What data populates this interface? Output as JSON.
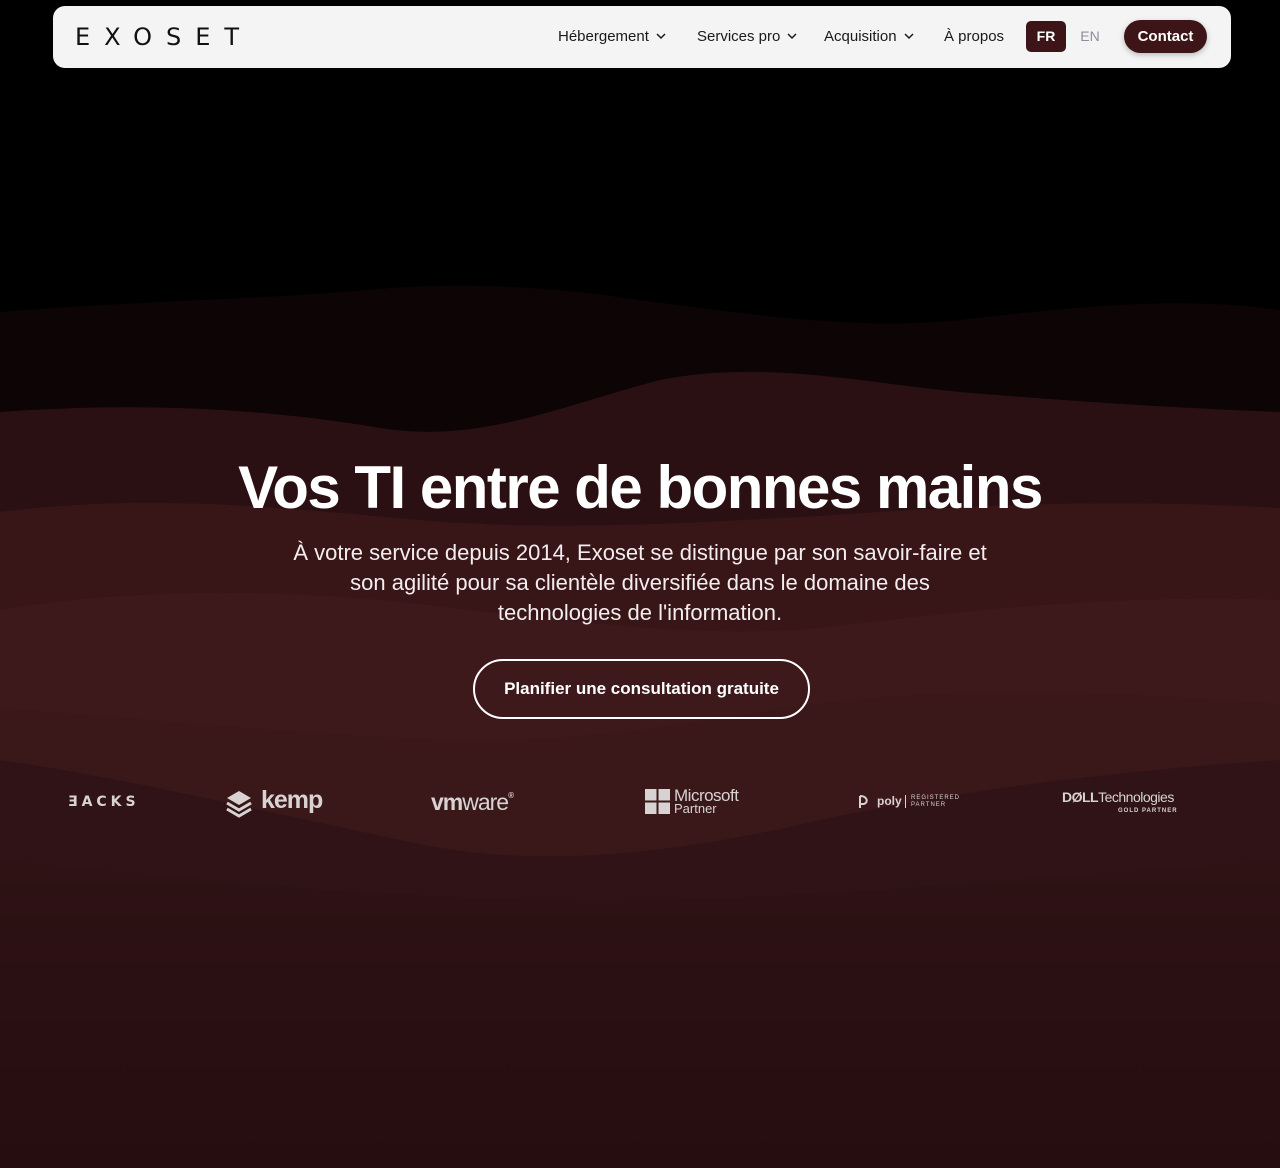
{
  "brand": {
    "logo_text": "EXOSET"
  },
  "nav": {
    "items": [
      {
        "label": "Hébergement",
        "has_dropdown": true
      },
      {
        "label": "Services pro",
        "has_dropdown": true
      },
      {
        "label": "Acquisition",
        "has_dropdown": true
      },
      {
        "label": "À propos",
        "has_dropdown": false
      }
    ],
    "lang_fr": "FR",
    "lang_en": "EN",
    "active_lang": "FR",
    "contact_label": "Contact"
  },
  "hero": {
    "title": "Vos TI entre de bonnes mains",
    "subtitle": "À votre service depuis 2014, Exoset se distingue par son savoir-faire et son agilité pour sa clientèle diversifiée dans le domaine des technologies de l'information.",
    "cta_label": "Planifier une consultation gratuite"
  },
  "partners": {
    "racks": "ƎACKS",
    "kemp": "kemp",
    "vmware_vm": "vm",
    "vmware_ware": "ware",
    "vmware_mark": "®",
    "microsoft_line1": "Microsoft",
    "microsoft_line2": "Partner",
    "poly": "poly",
    "poly_registered": "REGISTERED",
    "poly_partner": "PARTNER",
    "dell_brand": "DØLL",
    "dell_tech": "Technologies",
    "dell_gold": "GOLD PARTNER"
  },
  "colors": {
    "navbar_bg": "#f4f4f4",
    "accent_maroon": "#3d1518",
    "hero_bg_dark": "#000000",
    "hero_bg_red": "#3a1719"
  }
}
